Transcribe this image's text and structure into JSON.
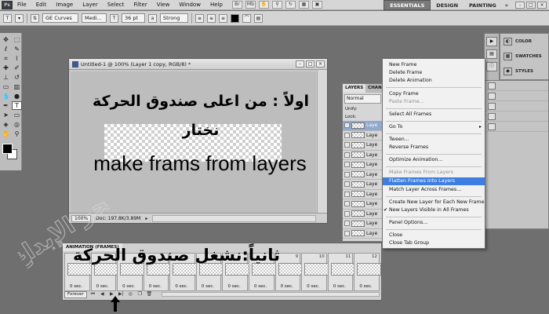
{
  "app": {
    "logo": "Ps",
    "menu": [
      "File",
      "Edit",
      "Image",
      "Layer",
      "Select",
      "Filter",
      "View",
      "Window",
      "Help"
    ],
    "workspaces": [
      "ESSENTIALS",
      "DESIGN",
      "PAINTING"
    ],
    "workspace_more": "»",
    "window_controls": [
      "–",
      "□",
      "×"
    ]
  },
  "options_bar": {
    "font_family": "GE Curves",
    "font_style": "Medi...",
    "font_size": "36 pt",
    "antialias": "Strong"
  },
  "document": {
    "title": "Untitled-1 @ 100% (Layer 1 copy, RGB/8) *",
    "zoom": "100%",
    "doc_size": "Doc: 197.8K/3.89M"
  },
  "overlay": {
    "line1": "اولاً : من اعلى صندوق الحركة",
    "line2": "نختار",
    "line3": "make frams from layers",
    "line4": "ثانياً:نشغل صندوق الحركة"
  },
  "layers_panel": {
    "tabs": [
      "LAYERS",
      "CHAN"
    ],
    "blend_mode": "Normal",
    "unify_label": "Unify:",
    "lock_label": "Lock:",
    "layer_name": "Laye"
  },
  "context_menu": {
    "items": [
      {
        "label": "New Frame",
        "state": "normal"
      },
      {
        "label": "Delete Frame",
        "state": "normal"
      },
      {
        "label": "Delete Animation",
        "state": "normal"
      },
      {
        "label": "Copy Frame",
        "state": "normal"
      },
      {
        "label": "Paste Frame...",
        "state": "disabled"
      },
      {
        "label": "Select All Frames",
        "state": "normal"
      },
      {
        "label": "Go To",
        "state": "normal",
        "submenu": true
      },
      {
        "label": "Tween...",
        "state": "normal"
      },
      {
        "label": "Reverse Frames",
        "state": "normal"
      },
      {
        "label": "Optimize Animation...",
        "state": "normal"
      },
      {
        "label": "Make Frames From Layers",
        "state": "disabled"
      },
      {
        "label": "Flatten Frames Into Layers",
        "state": "highlight"
      },
      {
        "label": "Match Layer Across Frames...",
        "state": "normal"
      },
      {
        "label": "Create New Layer for Each New Frame",
        "state": "normal"
      },
      {
        "label": "New Layers Visible in All Frames",
        "state": "normal",
        "checked": true
      },
      {
        "label": "Panel Options...",
        "state": "normal"
      },
      {
        "label": "Close",
        "state": "normal"
      },
      {
        "label": "Close Tab Group",
        "state": "normal"
      }
    ]
  },
  "right_panels": {
    "items": [
      "COLOR",
      "SWATCHES",
      "STYLES"
    ]
  },
  "animation_panel": {
    "tab": "ANIMATION (FRAMES)",
    "frames": [
      {
        "num": "",
        "delay": "0 sec."
      },
      {
        "num": "",
        "delay": "0 sec."
      },
      {
        "num": "",
        "delay": "0 sec."
      },
      {
        "num": "",
        "delay": "0 sec."
      },
      {
        "num": "",
        "delay": "0 sec."
      },
      {
        "num": "",
        "delay": "0 sec."
      },
      {
        "num": "",
        "delay": "0 sec."
      },
      {
        "num": "8",
        "delay": "0 sec."
      },
      {
        "num": "9",
        "delay": "0 sec."
      },
      {
        "num": "10",
        "delay": "0 sec."
      },
      {
        "num": "11",
        "delay": "0 sec."
      },
      {
        "num": "12",
        "delay": "0 sec."
      }
    ],
    "loop": "Forever"
  },
  "watermark": {
    "text": "بحر الإبداع"
  }
}
